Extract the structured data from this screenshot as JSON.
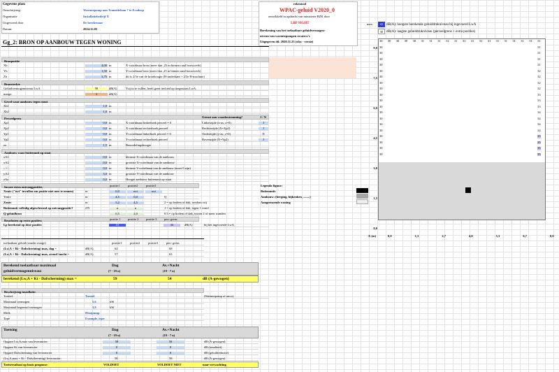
{
  "info": {
    "header": "Gegevens plan:",
    "rows": [
      {
        "label": "Omschrijving:",
        "value": "Warmtepomp aan Transitielaan 7 te Ecodorp"
      },
      {
        "label": "Organisatie",
        "value": "Installatiebedrijf X"
      },
      {
        "label": "Uitgevoerd door",
        "value": "De berekenaar"
      },
      {
        "label": "Datum:",
        "value": "2024.12.05"
      }
    ]
  },
  "rekentool": {
    "label": "rekentool",
    "title": "WPAC-geluid V2020_0",
    "subtitle": "ontwikkeld in opdracht van ministerie BZK door",
    "org": "LBP SIGHT",
    "desc1": "Berekening van het toelaatbare geluidvermogen-",
    "desc2": "niveau van warmtepompen en airco's",
    "issued": "Uitgegeven dd. 2020.11.23 (xlsx - versie)"
  },
  "legend_top": [
    {
      "tag": "max.",
      "value": "41",
      "text": "dB(A): hoogste berekende geluiddrukniveau bij ingevoerd LwA"
    },
    {
      "tag": "",
      "value": "30",
      "text": "dB(A): laagste geluiddrukniveau  (perceelgrens + extra posities)"
    }
  ],
  "section_title": "Gg_2: BRON OP AANBOUW TEGEN WONING",
  "bronpositie": {
    "header": "Bronpositie",
    "rows": [
      {
        "label": "Xb",
        "value": "4,00",
        "unit": "m",
        "desc": "X-coördinaat bron (meer dan ,25 m binnen rand bouwwerk)"
      },
      {
        "label": "Yb",
        "value": "1,50",
        "unit": "m",
        "desc": "Y-coördinaat bron (meer dan ,25 m binnen rand bouwwerk)"
      },
      {
        "label": "Zb",
        "value": "3,75",
        "unit": "m",
        "desc": "dit is 2/3e van de bronhoogte (H-onderkant + 2/3e H-machine)"
      }
    ]
  },
  "bronsterkte": {
    "header": "Bronsterkte",
    "rows": [
      {
        "label": "Geluidvermogenniveau LwA",
        "value": "58",
        "unit": "dB(A)",
        "desc": "Vrij in te vullen; heeft geen invloed op toegestaan LwA."
      },
      {
        "label": "marge:",
        "value": "3",
        "unit": "dB(A)",
        "desc": ""
      }
    ]
  },
  "gevel": {
    "header": "Gevel waar aanbouw tegen staat",
    "rows": [
      {
        "label": "Xh1",
        "value": "1,0",
        "unit": "m"
      },
      {
        "label": "Xh2",
        "value": "1,0",
        "unit": "m"
      }
    ]
  },
  "perceelgrens": {
    "header": "Perceelgrens",
    "header2": "Grenst aan woonbestemming?",
    "header3": "J / N",
    "rows": [
      {
        "label": "Xp1",
        "value": "0,0",
        "unit": "m",
        "desc": "X-coördinaat linkerhoek perceel = 0",
        "side": "Linkerzijde (x-as; x=0)",
        "yn": "J"
      },
      {
        "label": "Xp2",
        "value": "0,0",
        "unit": "m",
        "desc": "X-coördinaat rechterhoek perceel",
        "side": "Rechterzijde (X=Xp2)",
        "yn": "J"
      },
      {
        "label": "Yp1",
        "value": "0,0",
        "unit": "m",
        "desc": "Y-coördinaat linkerhoek perceel = 0",
        "side": "Onderzijde (y-as; y=0)",
        "yn": "N"
      },
      {
        "label": "Yp2",
        "value": "0,0",
        "unit": "m",
        "desc": "Y-coördinaat rechterhoek perceel",
        "side": "Bovenzijde (Y=Yp2)",
        "yn": "J"
      },
      {
        "label": "zo",
        "value": "1,5",
        "unit": "m",
        "desc": "Beoordelingshoogte",
        "side": "",
        "yn": ""
      }
    ]
  },
  "aanbouw": {
    "header": "Aanbouw waar buitenunit op staat",
    "rows": [
      {
        "label": "xA1",
        "value": "0,0",
        "unit": "m",
        "desc": "kleinste X-coördinaat van de aanbouw"
      },
      {
        "label": "xA2",
        "value": "0,0",
        "unit": "m",
        "desc": "grootste X-coördinaat van de aanbouw"
      },
      {
        "label": "yA1",
        "value": "0,0",
        "unit": "m",
        "desc": "kleinste Y-coördinaat van de aanbouw  (moet 0 zijn)"
      },
      {
        "label": "yA2",
        "value": "3,0",
        "unit": "m",
        "desc": "grootste Y-coördinaat van de aanbouw"
      },
      {
        "label": "zAa",
        "value": "0,0",
        "unit": "m",
        "desc": "Hoogte aanbouw buitenunit op staat"
      }
    ]
  },
  "extra": {
    "header": "Invoer extra ontvangposities",
    "cols": [
      "positie1",
      "positie2",
      "positie3"
    ],
    "rows": [
      {
        "label": "Xontv (\"nvt\" invullen om positie niet mee te nemen)",
        "unit": "m",
        "p1": "0,0",
        "p2": "nvt",
        "p3": "nvt",
        "desc": ""
      },
      {
        "label": "Yontv",
        "unit": "m",
        "p1": "4,5",
        "p2": "0,0",
        "p3": "",
        "desc": "Q"
      },
      {
        "label": "Zontv",
        "unit": "m",
        "p1": "5,2",
        "p2": "4,5",
        "p3": "",
        "desc": "2 = op bodem of dak, rondom vrij"
      },
      {
        "label": "Buitenunit volledig afgeschermd op ontvangpositie?",
        "unit": "J/N",
        "p1": "n",
        "p2": "n",
        "p3": "",
        "desc": "1 = op bodem of dak, tegen 1 wand"
      },
      {
        "label": "Q-geluidbron",
        "unit": "",
        "p1": "0,5",
        "p2": "2,0",
        "p3": "",
        "desc": "0.5 = op bodem of dak, tussen 2 of meer wanden"
      }
    ],
    "result_header": "Resultaten op extra posities:",
    "result_cols": [
      "positie 1",
      "positie 2",
      "positie 3",
      "perc grens"
    ],
    "result_label": "Lp berekend op deze positie:",
    "result_p1": "41",
    "result_pg": "35",
    "result_unit": "dB(A)",
    "result_note": "bij het ingevoerde LwA"
  },
  "legenda": {
    "header": "Legenda figuur:",
    "items": [
      {
        "label": "Buitenunit:"
      },
      {
        "label": "Aanbouw: (berging, bijkeuken, ........)"
      },
      {
        "label": "Aangrenzende woning"
      }
    ]
  },
  "toelaatbaar": {
    "header": "toelaatbaar geluid (zonder marge)",
    "cols": [
      "positie1",
      "positie2",
      "positie3",
      "perc grens"
    ],
    "rows": [
      {
        "label": "(Lw,A + Kt - Dafscherming) max, dag =",
        "unit": "dB(A)",
        "p1": "62",
        "pg": "68"
      },
      {
        "label": "(Lw,A + Kt - Dafscherming) max, avond+nacht =",
        "unit": "dB(A)",
        "p1": "57",
        "pg": "63"
      }
    ]
  },
  "maximaal": {
    "title1": "Berekend toelaatbaar maximaal",
    "title2": "geluidvermogenniveau:",
    "dag": "Dag",
    "dag_t": "(7 - 19 u)",
    "avn": "Av.+Nacht",
    "avn_t": "(19 - 7 u)",
    "label": "berekend (Lw,A + Kt - Dafscherming) max  =",
    "dag_value": "59",
    "avn_value": "54",
    "unit": "dB   (A-gewogen)"
  },
  "installatie": {
    "header": "Beschrijving installatie:",
    "rows": [
      {
        "label": "Toestel:",
        "value": "Toestel",
        "unit": "",
        "note": "(Warmtepomp of airco)"
      },
      {
        "label": "Maximaal vermogen",
        "value": "5,6",
        "unit": "kW",
        "note": ""
      },
      {
        "label": "Maximaal begrensd vermogen",
        "value": "3,8",
        "unit": "kW",
        "note": ""
      },
      {
        "label": "Merk",
        "value": "Heatpump",
        "unit": "",
        "note": ""
      },
      {
        "label": "Type",
        "value": "Example_type",
        "unit": "",
        "note": ""
      }
    ]
  },
  "toetsing": {
    "header": "Toetsing",
    "dag": "Dag",
    "dag_t": "(7 - 19 u)",
    "avn": "Av.+Nacht",
    "avn_t": "(19 - 7 u)",
    "rows": [
      {
        "label": "Opgave Lw,A,max van leverancier:",
        "dag": "58",
        "avn": "58",
        "unit": "dB   (A-gewogen)"
      },
      {
        "label": "Opgave Kt van leverancier",
        "dag": "0",
        "avn": "0",
        "unit": "dB   (tonaliteit)"
      },
      {
        "label": "Opgave Dafscherming van leverancier",
        "dag": "0",
        "avn": "0",
        "unit": "dB   (geluidreductie)"
      },
      {
        "label": "(Lw,A,max + Kt - Dafscherming)  leverancier:",
        "dag": "58",
        "avn": "58",
        "unit": "dB   (A-gewogen)"
      }
    ],
    "result_label": "Toetsresultaat op basis prognose:",
    "result_dag": "VOLDOET",
    "result_avn": "VOLDOET NIET",
    "result_note": "naar verwachting"
  },
  "chart": {
    "y_ticks": [
      "9,0",
      "7,5",
      "6,0",
      "4,5",
      "3,0",
      "1,5",
      "0,0"
    ],
    "x_label": "X (m)",
    "x_ticks": [
      "0,0",
      "1,3",
      "2,7",
      "4,0",
      "5,3",
      "6,7",
      "8,0"
    ],
    "grid_rows": [
      [
        "30",
        "30",
        "30",
        "30",
        "30",
        "31",
        "31",
        "31",
        "31",
        "31",
        "31",
        "31",
        "31",
        "31",
        "31",
        "31",
        "31",
        "31",
        "31",
        "31"
      ],
      [
        "",
        "",
        "",
        "",
        "",
        "",
        "",
        "",
        "",
        "",
        "",
        "",
        "",
        "",
        "",
        "",
        "",
        "",
        "",
        "31"
      ],
      [
        "",
        "",
        "",
        "",
        "",
        "",
        "",
        "",
        "",
        "",
        "",
        "",
        "",
        "",
        "",
        "",
        "",
        "",
        "",
        "31"
      ],
      [
        "",
        "",
        "",
        "",
        "",
        "",
        "",
        "",
        "",
        "",
        "",
        "",
        "",
        "",
        "",
        "",
        "",
        "",
        "",
        "31"
      ],
      [
        "",
        "",
        "",
        "",
        "",
        "",
        "",
        "",
        "",
        "",
        "",
        "",
        "",
        "",
        "",
        "",
        "",
        "",
        "",
        "31"
      ],
      [
        "",
        "",
        "",
        "",
        "",
        "",
        "",
        "",
        "",
        "",
        "",
        "",
        "",
        "",
        "",
        "",
        "",
        "",
        "",
        "32"
      ],
      [
        "",
        "",
        "",
        "",
        "",
        "",
        "",
        "",
        "",
        "",
        "",
        "",
        "",
        "",
        "",
        "",
        "",
        "",
        "",
        "32"
      ],
      [
        "",
        "",
        "",
        "",
        "",
        "",
        "",
        "",
        "",
        "",
        "",
        "",
        "",
        "",
        "",
        "",
        "",
        "",
        "",
        "32"
      ],
      [
        "",
        "",
        "",
        "",
        "",
        "",
        "",
        "",
        "",
        "",
        "",
        "",
        "",
        "",
        "",
        "",
        "",
        "",
        "",
        "32"
      ],
      [
        "",
        "",
        "",
        "",
        "",
        "",
        "",
        "",
        "",
        "",
        "",
        "",
        "",
        "",
        "",
        "",
        "",
        "",
        "",
        "33"
      ],
      [
        "",
        "",
        "",
        "",
        "",
        "",
        "",
        "",
        "",
        "",
        "",
        "",
        "",
        "",
        "",
        "",
        "",
        "",
        "",
        "33"
      ],
      [
        "",
        "",
        "",
        "",
        "",
        "",
        "",
        "",
        "",
        "",
        "",
        "",
        "",
        "",
        "",
        "",
        "",
        "",
        "",
        "33"
      ],
      [
        "",
        "",
        "",
        "",
        "",
        "",
        "",
        "",
        "",
        "",
        "",
        "",
        "",
        "",
        "",
        "",
        "",
        "",
        "",
        "34"
      ],
      [
        "",
        "",
        "",
        "",
        "",
        "",
        "",
        "",
        "",
        "",
        "",
        "",
        "",
        "",
        "",
        "",
        "",
        "",
        "",
        "34"
      ],
      [
        "",
        "",
        "",
        "",
        "",
        "",
        "",
        "",
        "",
        "",
        "",
        "",
        "",
        "",
        "",
        "",
        "",
        "",
        "",
        "34"
      ],
      [
        "",
        "",
        "",
        "",
        "",
        "",
        "",
        "",
        "",
        "",
        "",
        "",
        "",
        "",
        "",
        "",
        "",
        "",
        "",
        "34"
      ],
      [
        "",
        "",
        "",
        "",
        "",
        "",
        "",
        "",
        "",
        "",
        "",
        "",
        "",
        "",
        "",
        "",
        "",
        "",
        "",
        "35"
      ],
      [
        "",
        "",
        "",
        "",
        "",
        "",
        "",
        "",
        "",
        "",
        "",
        "",
        "",
        "",
        "",
        "",
        "",
        "",
        "",
        "35"
      ],
      [
        "",
        "",
        "",
        "",
        "",
        "",
        "",
        "",
        "",
        "",
        "",
        "",
        "",
        "",
        "",
        "",
        "",
        "",
        "",
        "35"
      ],
      [
        "",
        "",
        "",
        "",
        "",
        "",
        "",
        "",
        "",
        "",
        "",
        "",
        "",
        "",
        "",
        "",
        "",
        "",
        "",
        "35"
      ]
    ],
    "left_col": [
      "30",
      "30",
      "30",
      "30",
      "30",
      "30",
      "30",
      "30",
      "30",
      "30",
      "30",
      "30",
      "30",
      "30",
      "30",
      "30",
      "30",
      "30",
      "30",
      "30"
    ],
    "source_fraction_x": 0.5,
    "source_fraction_y": 0.16,
    "annex_fraction": 0.33
  }
}
